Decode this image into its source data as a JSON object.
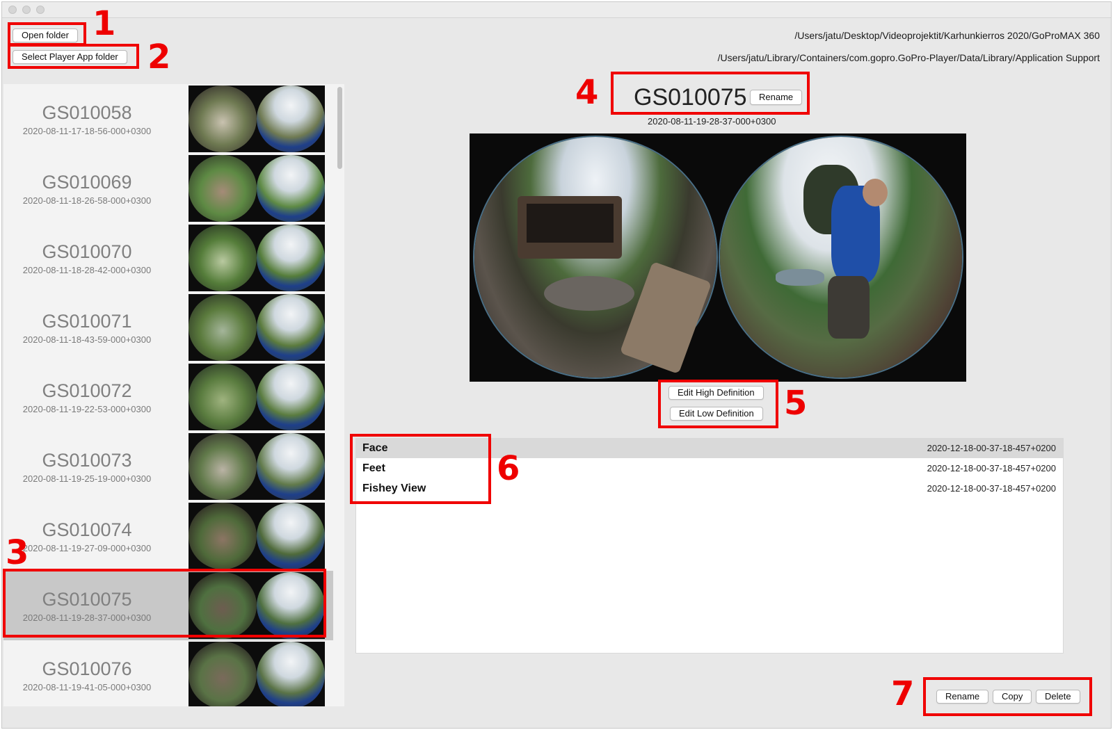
{
  "toolbar": {
    "open_folder_label": "Open folder",
    "select_player_label": "Select Player App folder",
    "folder_path": "/Users/jatu/Desktop/Videoprojektit/Karhunkierros 2020/GoProMAX 360",
    "player_path": "/Users/jatu/Library/Containers/com.gopro.GoPro-Player/Data/Library/Application Support"
  },
  "clips": [
    {
      "name": "GS010058",
      "date": "2020-08-11-17-18-56-000+0300"
    },
    {
      "name": "GS010069",
      "date": "2020-08-11-18-26-58-000+0300"
    },
    {
      "name": "GS010070",
      "date": "2020-08-11-18-28-42-000+0300"
    },
    {
      "name": "GS010071",
      "date": "2020-08-11-18-43-59-000+0300"
    },
    {
      "name": "GS010072",
      "date": "2020-08-11-19-22-53-000+0300"
    },
    {
      "name": "GS010073",
      "date": "2020-08-11-19-25-19-000+0300"
    },
    {
      "name": "GS010074",
      "date": "2020-08-11-19-27-09-000+0300"
    },
    {
      "name": "GS010075",
      "date": "2020-08-11-19-28-37-000+0300"
    },
    {
      "name": "GS010076",
      "date": "2020-08-11-19-41-05-000+0300"
    }
  ],
  "selected_clip_index": 7,
  "detail": {
    "title": "GS010075",
    "rename_label": "Rename",
    "date": "2020-08-11-19-28-37-000+0300",
    "edit_hd_label": "Edit High Definition",
    "edit_ld_label": "Edit Low Definition"
  },
  "bookmarks": [
    {
      "name": "Face",
      "date": "2020-12-18-00-37-18-457+0200"
    },
    {
      "name": "Feet",
      "date": "2020-12-18-00-37-18-457+0200"
    },
    {
      "name": "Fishey View",
      "date": "2020-12-18-00-37-18-457+0200"
    }
  ],
  "footer": {
    "rename_label": "Rename",
    "copy_label": "Copy",
    "delete_label": "Delete"
  },
  "callouts": [
    "1",
    "2",
    "3",
    "4",
    "5",
    "6",
    "7"
  ],
  "colors": {
    "annotation_red": "#f00000",
    "window_bg": "#e8e8e8",
    "list_bg": "#f3f3f3",
    "selected_row": "#c8c8c8"
  }
}
